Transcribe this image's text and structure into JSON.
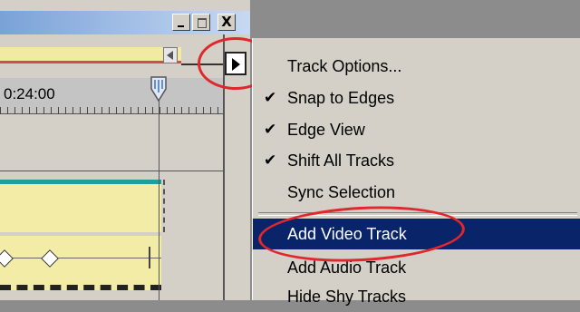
{
  "window": {
    "minimize_glyph": "_",
    "close_glyph": "X"
  },
  "timeline": {
    "current_time": "0:24:00"
  },
  "menu": {
    "items": [
      {
        "label": "Track Options...",
        "checked": false
      },
      {
        "label": "Snap to Edges",
        "checked": true
      },
      {
        "label": "Edge View",
        "checked": true
      },
      {
        "label": "Shift All Tracks",
        "checked": true
      },
      {
        "label": "Sync Selection",
        "checked": false
      },
      {
        "label": "Add Video Track",
        "checked": false,
        "highlighted": true
      },
      {
        "label": "Add Audio Track",
        "checked": false
      },
      {
        "label": "Hide Shy Tracks",
        "checked": false
      }
    ],
    "check_glyph": "✔"
  },
  "colors": {
    "highlight": "#0a246a",
    "annotation_ring": "#e0282c",
    "clip_fill": "#f3eca6",
    "clip_border": "#1f9f9a"
  }
}
